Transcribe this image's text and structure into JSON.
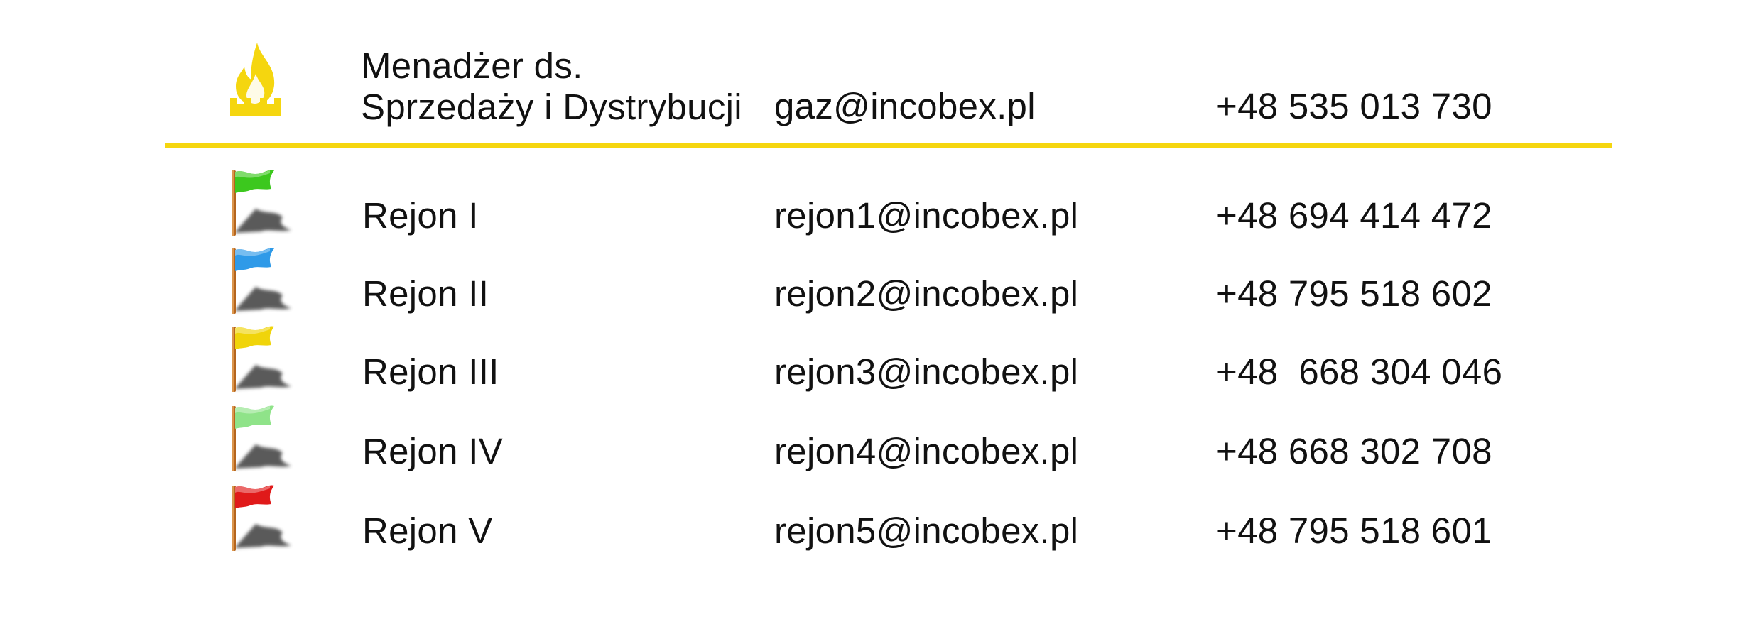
{
  "manager": {
    "icon": "gas-flame-icon",
    "title_line1": "Menadżer ds.",
    "title_line2": "Sprzedaży i Dystrybucji",
    "email": "gaz@incobex.pl",
    "phone": "+48 535 013 730"
  },
  "divider_color": "#f5d60f",
  "regions": [
    {
      "flag_color": "#3cc81e",
      "flag_icon": "green-flag-icon",
      "name": "Rejon I",
      "email": "rejon1@incobex.pl",
      "phone": "+48 694 414 472"
    },
    {
      "flag_color": "#2f9ae8",
      "flag_icon": "blue-flag-icon",
      "name": "Rejon II",
      "email": "rejon2@incobex.pl",
      "phone": "+48 795 518 602"
    },
    {
      "flag_color": "#f0d40a",
      "flag_icon": "yellow-flag-icon",
      "name": "Rejon III",
      "email": "rejon3@incobex.pl",
      "phone": "+48  668 304 046"
    },
    {
      "flag_color": "#8fe389",
      "flag_icon": "light-green-flag-icon",
      "name": "Rejon IV",
      "email": "rejon4@incobex.pl",
      "phone": "+48 668 302 708"
    },
    {
      "flag_color": "#e01a1a",
      "flag_icon": "red-flag-icon",
      "name": "Rejon V",
      "email": "rejon5@incobex.pl",
      "phone": "+48 795 518 601"
    }
  ]
}
